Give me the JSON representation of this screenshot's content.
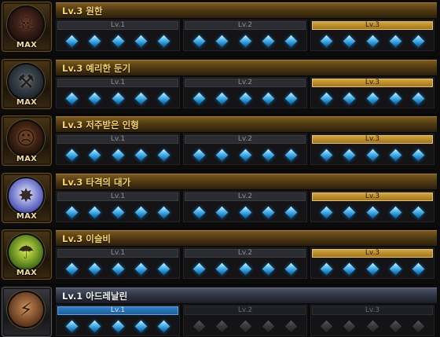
{
  "skills": [
    {
      "title": "Lv.3 원한",
      "max_label": "MAX",
      "icon": "dark-figure-icon",
      "orb_colors": [
        "#5a2f24",
        "#1a0d0a"
      ],
      "levels": [
        {
          "label": "Lv.1",
          "style": "plain",
          "gems_active": 5
        },
        {
          "label": "Lv.2",
          "style": "plain",
          "gems_active": 5
        },
        {
          "label": "Lv.3",
          "style": "gold",
          "gems_active": 5
        }
      ]
    },
    {
      "title": "Lv.3 예리한 둔기",
      "max_label": "MAX",
      "icon": "blunt-weapon-icon",
      "orb_colors": [
        "#4f5a62",
        "#182026"
      ],
      "levels": [
        {
          "label": "Lv.1",
          "style": "plain",
          "gems_active": 5
        },
        {
          "label": "Lv.2",
          "style": "plain",
          "gems_active": 5
        },
        {
          "label": "Lv.3",
          "style": "gold",
          "gems_active": 5
        }
      ]
    },
    {
      "title": "Lv.3 저주받은 인형",
      "max_label": "MAX",
      "icon": "cursed-doll-icon",
      "orb_colors": [
        "#6a3a1e",
        "#1d0f08"
      ],
      "levels": [
        {
          "label": "Lv.1",
          "style": "plain",
          "gems_active": 5
        },
        {
          "label": "Lv.2",
          "style": "plain",
          "gems_active": 5
        },
        {
          "label": "Lv.3",
          "style": "gold",
          "gems_active": 5
        }
      ]
    },
    {
      "title": "Lv.3 타격의 대가",
      "max_label": "MAX",
      "icon": "impact-burst-icon",
      "orb_colors": [
        "#dfe9ff",
        "#3a3fae"
      ],
      "levels": [
        {
          "label": "Lv.1",
          "style": "plain",
          "gems_active": 5
        },
        {
          "label": "Lv.2",
          "style": "plain",
          "gems_active": 5
        },
        {
          "label": "Lv.3",
          "style": "gold",
          "gems_active": 5
        }
      ]
    },
    {
      "title": "Lv.3 이슬비",
      "max_label": "MAX",
      "icon": "drizzle-icon",
      "orb_colors": [
        "#d6ef4a",
        "#2f5a10"
      ],
      "levels": [
        {
          "label": "Lv.1",
          "style": "plain",
          "gems_active": 5
        },
        {
          "label": "Lv.2",
          "style": "plain",
          "gems_active": 5
        },
        {
          "label": "Lv.3",
          "style": "gold",
          "gems_active": 5
        }
      ]
    },
    {
      "title": "Lv.1 아드레날린",
      "max_label": "",
      "icon": "adrenaline-runner-icon",
      "orb_colors": [
        "#c98a55",
        "#4a2814"
      ],
      "levels": [
        {
          "label": "Lv.1",
          "style": "blue",
          "gems_active": 5
        },
        {
          "label": "Lv.2",
          "style": "dim",
          "gems_active": 0
        },
        {
          "label": "Lv.3",
          "style": "dim",
          "gems_active": 0
        }
      ]
    }
  ]
}
